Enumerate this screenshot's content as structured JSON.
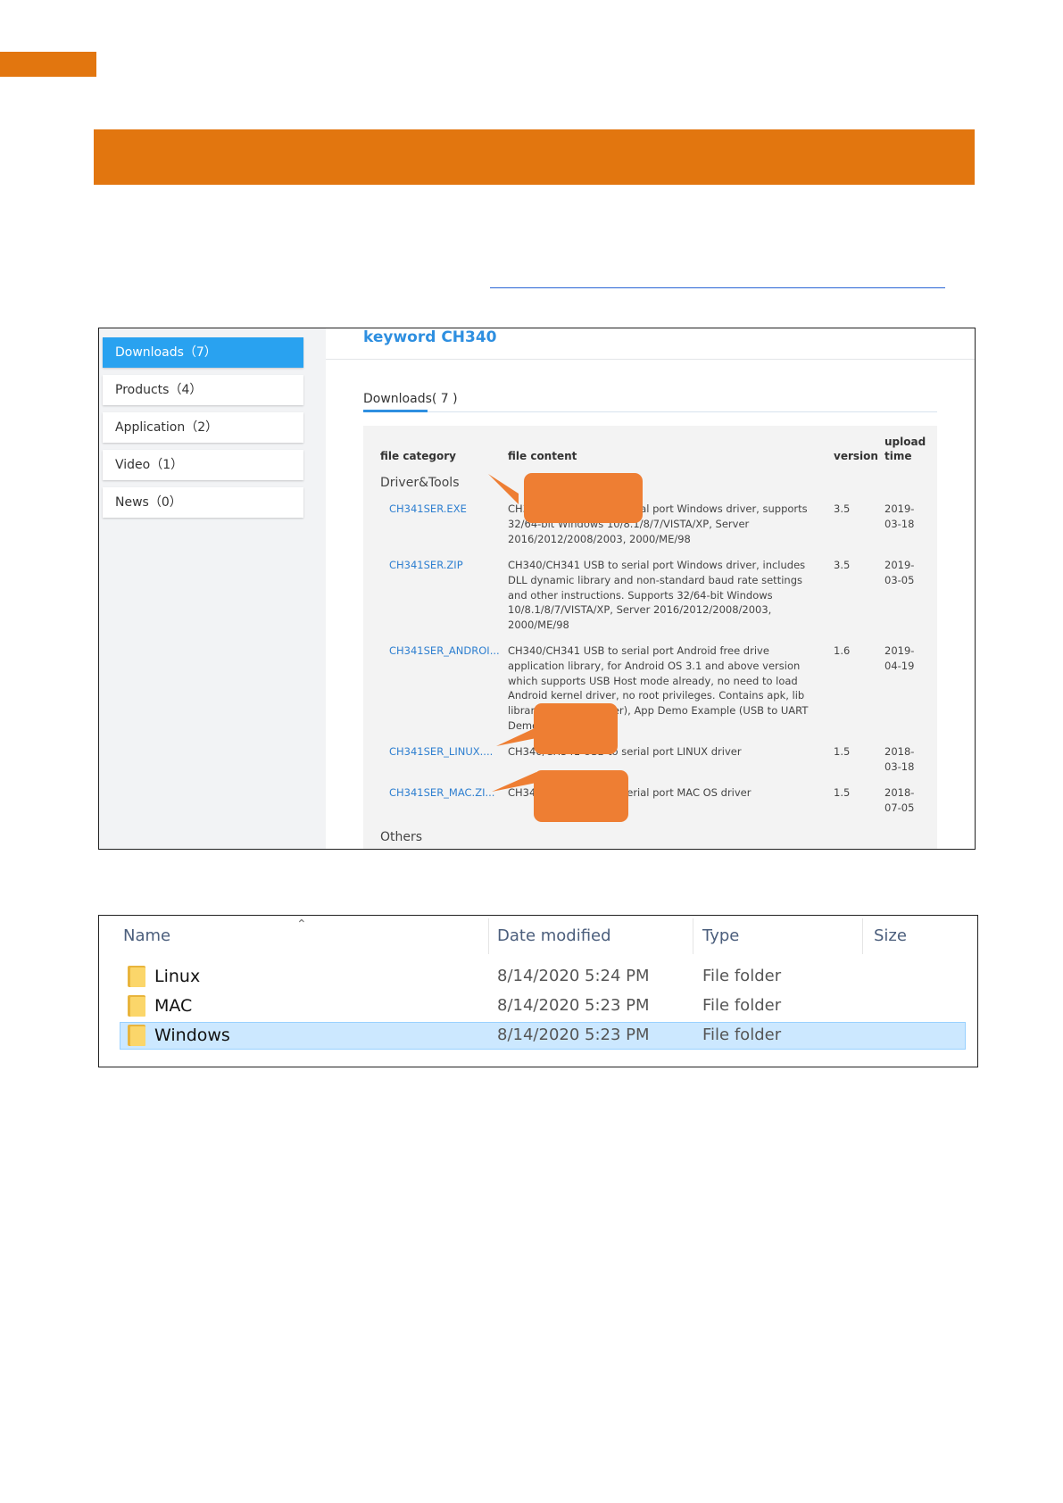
{
  "colors": {
    "accent": "#e2760f",
    "callout": "#ee7e33",
    "link": "#2e8fe0",
    "selected_row": "#cce8ff"
  },
  "download_page": {
    "sidebar": [
      {
        "label": "Downloads（7）",
        "active": true
      },
      {
        "label": "Products（4）",
        "active": false
      },
      {
        "label": "Application（2）",
        "active": false
      },
      {
        "label": "Video（1）",
        "active": false
      },
      {
        "label": "News（0）",
        "active": false
      }
    ],
    "keyword": "keyword CH340",
    "tab_label": "Downloads( 7 )",
    "headers": {
      "category": "file category",
      "content": "file content",
      "version": "version",
      "upload_time": "upload\ntime"
    },
    "group_driver": "Driver&Tools",
    "group_others": "Others",
    "files": [
      {
        "name": "CH341SER.EXE",
        "desc": "CH340/CH341 USB to serial port Windows driver, supports 32/64-bit Windows 10/8.1/8/7/VISTA/XP, Server 2016/2012/2008/2003, 2000/ME/98",
        "version": "3.5",
        "date": "2019-\n03-18"
      },
      {
        "name": "CH341SER.ZIP",
        "desc": "CH340/CH341 USB to serial port Windows driver, includes DLL dynamic library and non-standard baud rate settings and other instructions. Supports 32/64-bit Windows 10/8.1/8/7/VISTA/XP, Server 2016/2012/2008/2003, 2000/ME/98",
        "version": "3.5",
        "date": "2019-\n03-05"
      },
      {
        "name": "CH341SER_ANDROI...",
        "desc": "CH340/CH341 USB to serial port Android free drive application library, for Android OS 3.1 and above version which supports USB Host mode already, no need to load Android kernel driver, no root privileges. Contains apk, lib library file (Java Driver), App Demo Example (USB to UART Demo SDK)",
        "version": "1.6",
        "date": "2019-\n04-19"
      },
      {
        "name": "CH341SER_LINUX....",
        "desc": "CH340/CH341 USB to serial port LINUX driver",
        "version": "1.5",
        "date": "2018-\n03-18"
      },
      {
        "name": "CH341SER_MAC.ZI...",
        "desc": "CH340/CH341 USB to serial port MAC OS driver",
        "version": "1.5",
        "date": "2018-\n07-05"
      }
    ]
  },
  "explorer": {
    "columns": {
      "name": "Name",
      "date": "Date modified",
      "type": "Type",
      "size": "Size"
    },
    "rows": [
      {
        "name": "Linux",
        "date": "8/14/2020 5:24 PM",
        "type": "File folder",
        "selected": false
      },
      {
        "name": "MAC",
        "date": "8/14/2020 5:23 PM",
        "type": "File folder",
        "selected": false
      },
      {
        "name": "Windows",
        "date": "8/14/2020 5:23 PM",
        "type": "File folder",
        "selected": true
      }
    ]
  }
}
